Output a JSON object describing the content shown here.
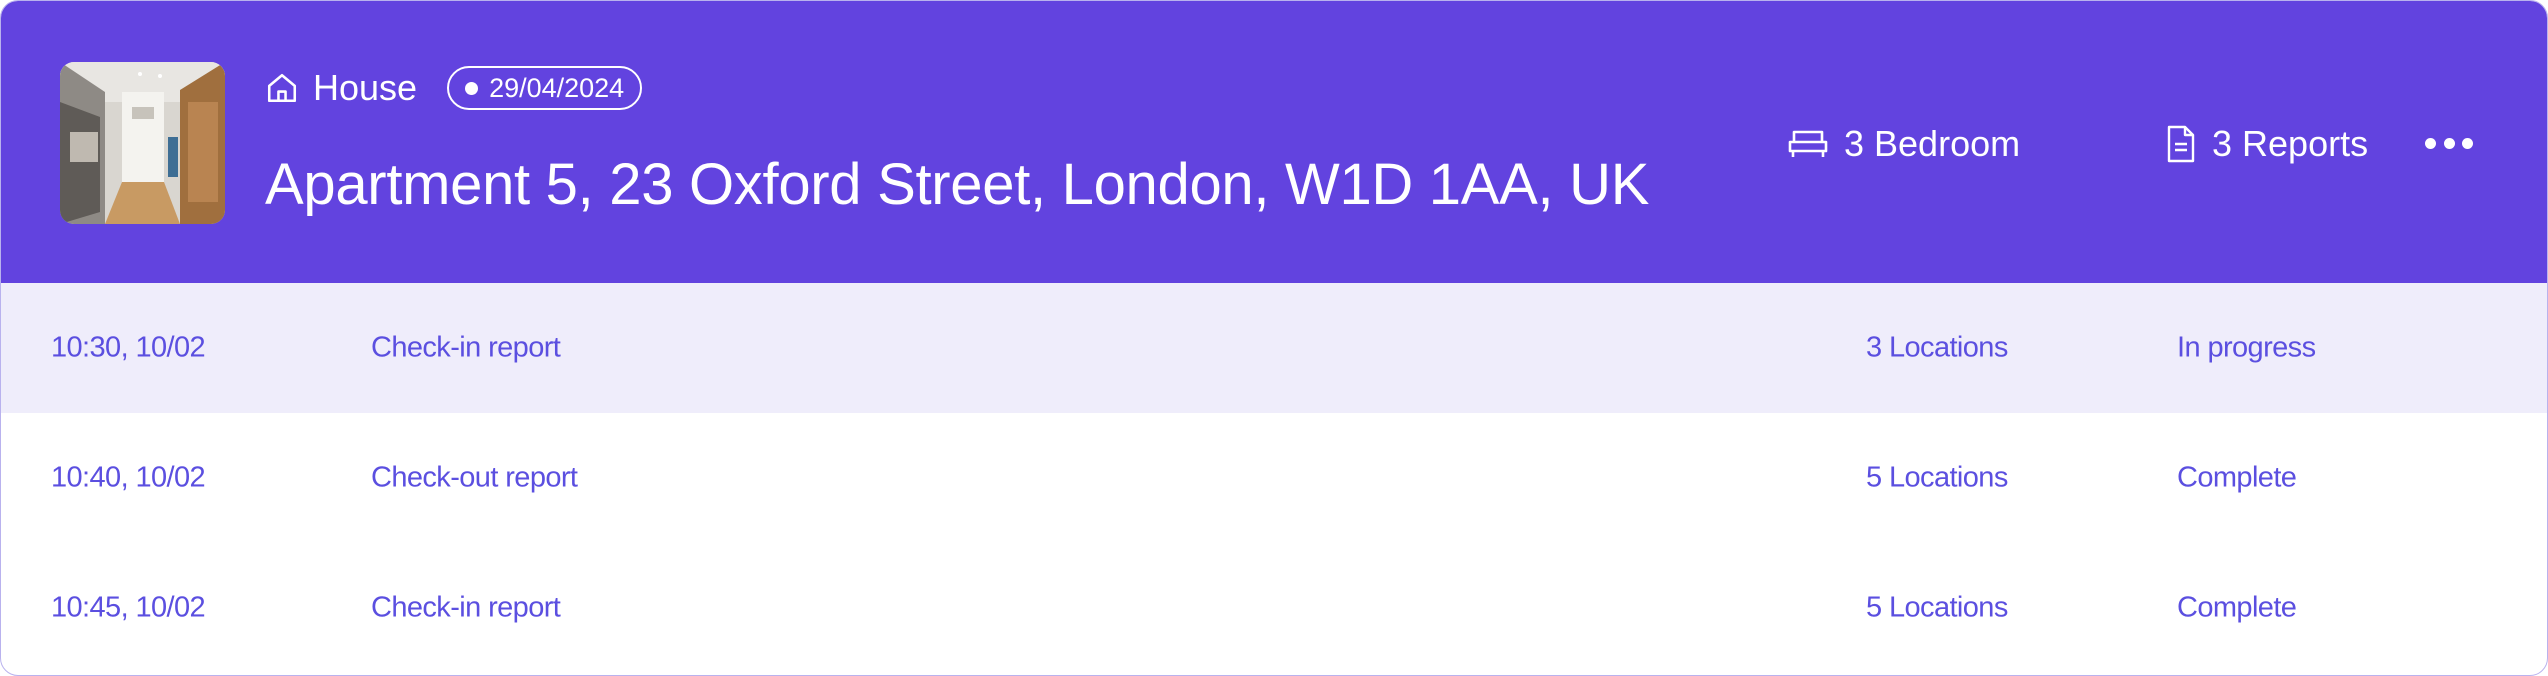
{
  "property": {
    "type_label": "House",
    "date": "29/04/2024",
    "address": "Apartment 5, 23 Oxford Street, London, W1D 1AA, UK",
    "bedrooms": "3 Bedroom",
    "reports_count": "3 Reports"
  },
  "reports": [
    {
      "time": "10:30, 10/02",
      "name": "Check-in report",
      "locations": "3 Locations",
      "status": "In progress"
    },
    {
      "time": "10:40, 10/02",
      "name": "Check-out report",
      "locations": "5 Locations",
      "status": "Complete"
    },
    {
      "time": "10:45, 10/02",
      "name": "Check-in report",
      "locations": "5 Locations",
      "status": "Complete"
    }
  ],
  "colors": {
    "header_bg": "#6243df",
    "row_text": "#5b4fe0",
    "active_row_bg": "#efedfb",
    "border": "#b9b2ee"
  },
  "icons": {
    "type": "house-icon",
    "bed": "bed-icon",
    "reports": "document-icon",
    "more": "more-horizontal-icon"
  }
}
